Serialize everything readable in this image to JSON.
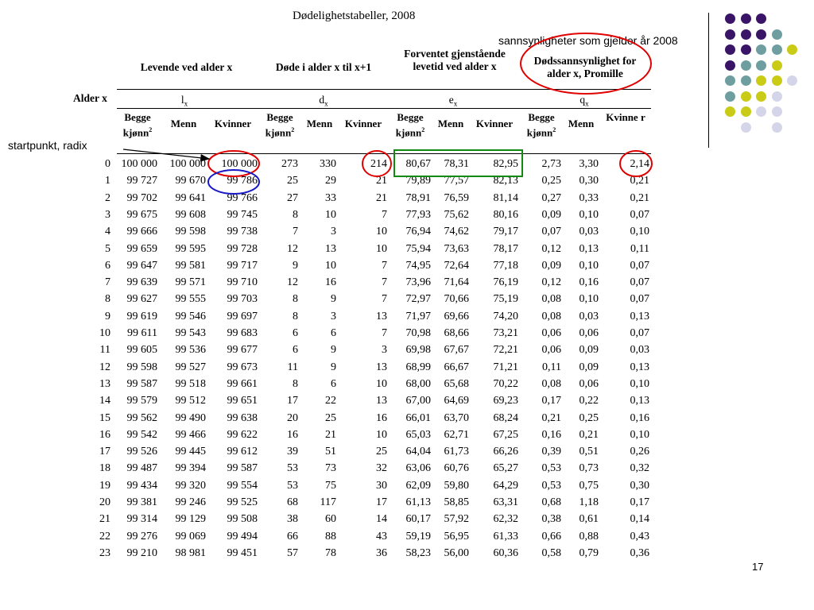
{
  "title": "Dødelighetstabeller, 2008",
  "slide_number": "17",
  "annotations": {
    "sannsynligheter": "sannsynligheter som gjelder år 2008",
    "startpunkt": "startpunkt, radix"
  },
  "headers": {
    "alder": "Alder x",
    "levende": "Levende ved alder x",
    "dode": "Døde i alder x til x+1",
    "forventet": "Forventet gjenstående levetid ved alder x",
    "dodssannsynlighet": "Dødssannsynlighet for alder x, Promille"
  },
  "symbols": {
    "l": {
      "base": "l",
      "sub": "x"
    },
    "d": {
      "base": "d",
      "sub": "x"
    },
    "e": {
      "base": "e",
      "sub": "x"
    },
    "q": {
      "base": "q",
      "sub": "x"
    }
  },
  "subheaders": {
    "begge": "Begge kjønn",
    "begge_sup": "2",
    "menn": "Menn",
    "kvinner": "Kvinner",
    "kvinne_split": "Kvinne r"
  },
  "colors": {
    "purple_dark": "#3a1466",
    "teal": "#6e9ea0",
    "lime": "#c9cb16",
    "lavender": "#d5d5e9",
    "circle_red": "#e00000",
    "circle_blue": "#1818c8",
    "box_green": "#108a10"
  },
  "table": {
    "rows": [
      [
        "0",
        "100 000",
        "100 000",
        "100 000",
        "273",
        "330",
        "214",
        "80,67",
        "78,31",
        "82,95",
        "2,73",
        "3,30",
        "2,14"
      ],
      [
        "1",
        "99 727",
        "99 670",
        "99 786",
        "25",
        "29",
        "21",
        "79,89",
        "77,57",
        "82,13",
        "0,25",
        "0,30",
        "0,21"
      ],
      [
        "2",
        "99 702",
        "99 641",
        "99 766",
        "27",
        "33",
        "21",
        "78,91",
        "76,59",
        "81,14",
        "0,27",
        "0,33",
        "0,21"
      ],
      [
        "3",
        "99 675",
        "99 608",
        "99 745",
        "8",
        "10",
        "7",
        "77,93",
        "75,62",
        "80,16",
        "0,09",
        "0,10",
        "0,07"
      ],
      [
        "4",
        "99 666",
        "99 598",
        "99 738",
        "7",
        "3",
        "10",
        "76,94",
        "74,62",
        "79,17",
        "0,07",
        "0,03",
        "0,10"
      ],
      [
        "5",
        "99 659",
        "99 595",
        "99 728",
        "12",
        "13",
        "10",
        "75,94",
        "73,63",
        "78,17",
        "0,12",
        "0,13",
        "0,11"
      ],
      [
        "6",
        "99 647",
        "99 581",
        "99 717",
        "9",
        "10",
        "7",
        "74,95",
        "72,64",
        "77,18",
        "0,09",
        "0,10",
        "0,07"
      ],
      [
        "7",
        "99 639",
        "99 571",
        "99 710",
        "12",
        "16",
        "7",
        "73,96",
        "71,64",
        "76,19",
        "0,12",
        "0,16",
        "0,07"
      ],
      [
        "8",
        "99 627",
        "99 555",
        "99 703",
        "8",
        "9",
        "7",
        "72,97",
        "70,66",
        "75,19",
        "0,08",
        "0,10",
        "0,07"
      ],
      [
        "9",
        "99 619",
        "99 546",
        "99 697",
        "8",
        "3",
        "13",
        "71,97",
        "69,66",
        "74,20",
        "0,08",
        "0,03",
        "0,13"
      ],
      [
        "10",
        "99 611",
        "99 543",
        "99 683",
        "6",
        "6",
        "7",
        "70,98",
        "68,66",
        "73,21",
        "0,06",
        "0,06",
        "0,07"
      ],
      [
        "11",
        "99 605",
        "99 536",
        "99 677",
        "6",
        "9",
        "3",
        "69,98",
        "67,67",
        "72,21",
        "0,06",
        "0,09",
        "0,03"
      ],
      [
        "12",
        "99 598",
        "99 527",
        "99 673",
        "11",
        "9",
        "13",
        "68,99",
        "66,67",
        "71,21",
        "0,11",
        "0,09",
        "0,13"
      ],
      [
        "13",
        "99 587",
        "99 518",
        "99 661",
        "8",
        "6",
        "10",
        "68,00",
        "65,68",
        "70,22",
        "0,08",
        "0,06",
        "0,10"
      ],
      [
        "14",
        "99 579",
        "99 512",
        "99 651",
        "17",
        "22",
        "13",
        "67,00",
        "64,69",
        "69,23",
        "0,17",
        "0,22",
        "0,13"
      ],
      [
        "15",
        "99 562",
        "99 490",
        "99 638",
        "20",
        "25",
        "16",
        "66,01",
        "63,70",
        "68,24",
        "0,21",
        "0,25",
        "0,16"
      ],
      [
        "16",
        "99 542",
        "99 466",
        "99 622",
        "16",
        "21",
        "10",
        "65,03",
        "62,71",
        "67,25",
        "0,16",
        "0,21",
        "0,10"
      ],
      [
        "17",
        "99 526",
        "99 445",
        "99 612",
        "39",
        "51",
        "25",
        "64,04",
        "61,73",
        "66,26",
        "0,39",
        "0,51",
        "0,26"
      ],
      [
        "18",
        "99 487",
        "99 394",
        "99 587",
        "53",
        "73",
        "32",
        "63,06",
        "60,76",
        "65,27",
        "0,53",
        "0,73",
        "0,32"
      ],
      [
        "19",
        "99 434",
        "99 320",
        "99 554",
        "53",
        "75",
        "30",
        "62,09",
        "59,80",
        "64,29",
        "0,53",
        "0,75",
        "0,30"
      ],
      [
        "20",
        "99 381",
        "99 246",
        "99 525",
        "68",
        "117",
        "17",
        "61,13",
        "58,85",
        "63,31",
        "0,68",
        "1,18",
        "0,17"
      ],
      [
        "21",
        "99 314",
        "99 129",
        "99 508",
        "38",
        "60",
        "14",
        "60,17",
        "57,92",
        "62,32",
        "0,38",
        "0,61",
        "0,14"
      ],
      [
        "22",
        "99 276",
        "99 069",
        "99 494",
        "66",
        "88",
        "43",
        "59,19",
        "56,95",
        "61,33",
        "0,66",
        "0,88",
        "0,43"
      ],
      [
        "23",
        "99 210",
        "98 981",
        "99 451",
        "57",
        "78",
        "36",
        "58,23",
        "56,00",
        "60,36",
        "0,58",
        "0,79",
        "0,36"
      ]
    ]
  }
}
